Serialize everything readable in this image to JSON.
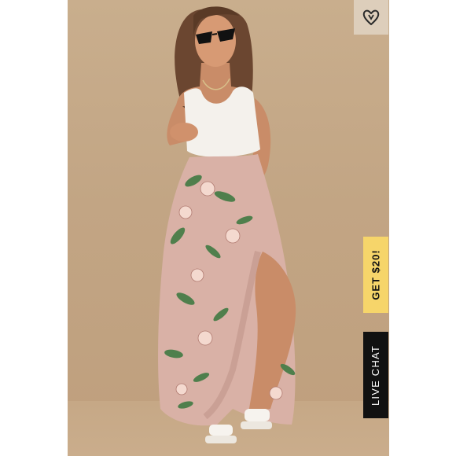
{
  "promo_tab": {
    "label": "GET $20!"
  },
  "chat_tab": {
    "label": "LIVE CHAT"
  },
  "wishlist": {
    "icon": "heart-icon"
  },
  "colors": {
    "backdrop": "#c3a685",
    "promo_bg": "#f6d56a",
    "chat_bg": "#111111",
    "skirt": "#d9b1a6",
    "leaf": "#4f7f4c"
  }
}
